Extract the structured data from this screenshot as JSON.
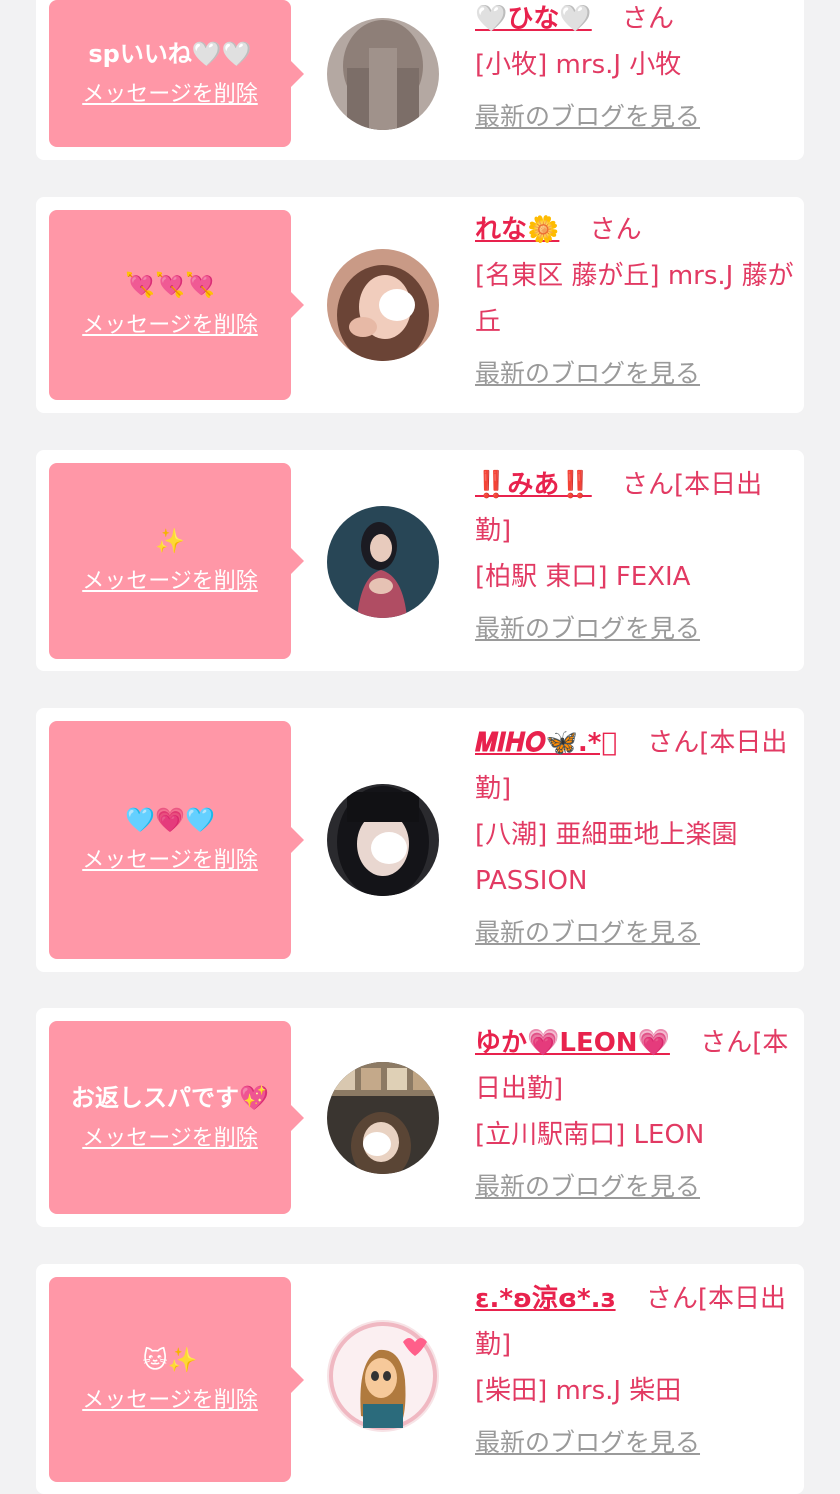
{
  "colors": {
    "background": "#f2f2f3",
    "card": "#ffffff",
    "bubble": "#ff97a7",
    "name": "#e8224d",
    "shop": "#e23a63",
    "blog_link": "#9a9a9a"
  },
  "delete_label": "メッセージを削除",
  "blog_label": "最新のブログを見る",
  "items": [
    {
      "message": "spいいね🤍🤍",
      "name": "🤍ひな🤍",
      "suffix": "さん",
      "shop": "[小牧] mrs.J 小牧",
      "delete_label": "メッセージを削除",
      "blog_label": "最新のブログを見る"
    },
    {
      "message": "💘💘💘",
      "name": "れな🌼",
      "suffix": "さん",
      "shop": "[名東区 藤が丘] mrs.J 藤が丘",
      "delete_label": "メッセージを削除",
      "blog_label": "最新のブログを見る"
    },
    {
      "message": "✨",
      "name": "‼️みあ‼️",
      "suffix": "さん[本日出勤]",
      "shop": "[柏駅 東口] FEXIA",
      "delete_label": "メッセージを削除",
      "blog_label": "最新のブログを見る"
    },
    {
      "message": "🩵💗🩵",
      "name": "𝑴𝑰𝑯𝑶🦋.*ﾟ",
      "suffix": "さん[本日出勤]",
      "shop": "[八潮] 亜細亜地上楽園PASSION",
      "delete_label": "メッセージを削除",
      "blog_label": "最新のブログを見る"
    },
    {
      "message": "お返しスパです💖",
      "name": "ゆか💗LEON💗",
      "suffix": "さん[本日出勤]",
      "shop": "[立川駅南口] LEON",
      "delete_label": "メッセージを削除",
      "blog_label": "最新のブログを見る"
    },
    {
      "message": "🐱✨",
      "name": "ε.*ʚ涼ɞ*.з",
      "suffix": "さん[本日出勤]",
      "shop": "[柴田] mrs.J 柴田",
      "delete_label": "メッセージを削除",
      "blog_label": "最新のブログを見る"
    }
  ]
}
